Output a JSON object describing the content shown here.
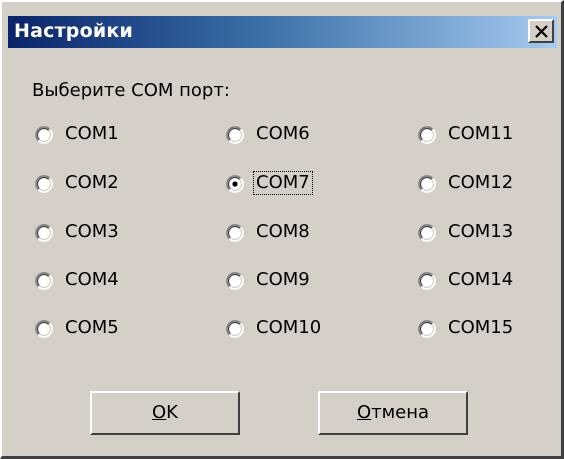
{
  "window": {
    "title": "Настройки",
    "close_icon": "close-icon"
  },
  "prompt_label": "Выберите COM порт:",
  "ports": [
    {
      "label": "COM1",
      "selected": false
    },
    {
      "label": "COM2",
      "selected": false
    },
    {
      "label": "COM3",
      "selected": false
    },
    {
      "label": "COM4",
      "selected": false
    },
    {
      "label": "COM5",
      "selected": false
    },
    {
      "label": "COM6",
      "selected": false
    },
    {
      "label": "COM7",
      "selected": true
    },
    {
      "label": "COM8",
      "selected": false
    },
    {
      "label": "COM9",
      "selected": false
    },
    {
      "label": "COM10",
      "selected": false
    },
    {
      "label": "COM11",
      "selected": false
    },
    {
      "label": "COM12",
      "selected": false
    },
    {
      "label": "COM13",
      "selected": false
    },
    {
      "label": "COM14",
      "selected": false
    },
    {
      "label": "COM15",
      "selected": false
    }
  ],
  "buttons": {
    "ok_mnemonic": "O",
    "ok_rest": "K",
    "cancel_mnemonic": "О",
    "cancel_rest": "тмена"
  },
  "colors": {
    "face": "#d4d0c8",
    "title_start": "#0a246a",
    "title_end": "#a6caf0"
  }
}
